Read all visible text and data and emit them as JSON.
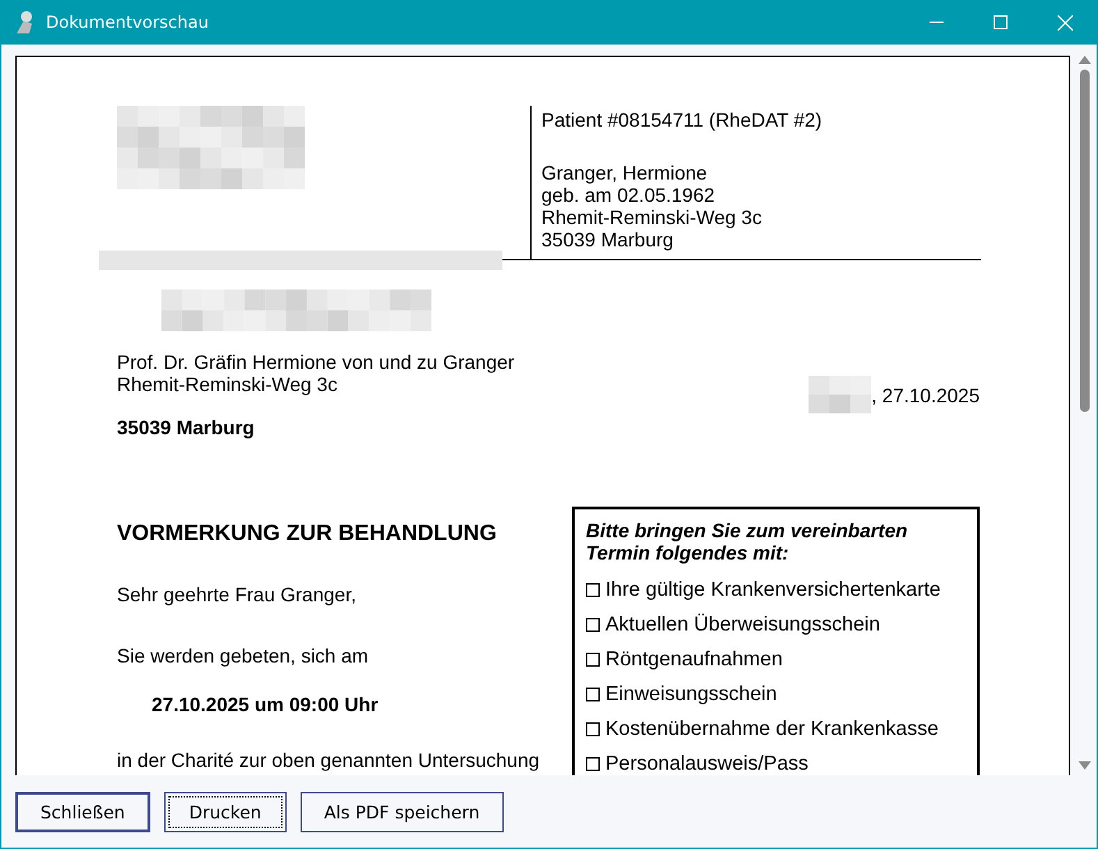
{
  "window": {
    "title": "Dokumentvorschau"
  },
  "document": {
    "patient_header": "Patient #08154711 (RheDAT #2)",
    "patient_lines": [
      "Granger, Hermione",
      "geb. am 02.05.1962",
      "Rhemit-Reminski-Weg 3c",
      "35039 Marburg"
    ],
    "recipient_lines": [
      "Prof. Dr. Gräfin Hermione von und zu Granger",
      "Rhemit-Reminski-Weg 3c"
    ],
    "recipient_city": "35039 Marburg",
    "date": ", 27.10.2025",
    "heading": "VORMERKUNG ZUR BEHANDLUNG",
    "salutation": "Sehr geehrte Frau Granger,",
    "intro": "Sie werden gebeten, sich am",
    "appointment": "27.10.2025 um 09:00 Uhr",
    "body": "in der Charité zur oben genannten Untersuchung",
    "checklist": {
      "title": "Bitte bringen Sie zum vereinbarten Termin folgendes mit:",
      "items": [
        {
          "label": "Ihre gültige Krankenversichertenkarte",
          "checked": false
        },
        {
          "label": "Aktuellen Überweisungsschein",
          "checked": false
        },
        {
          "label": "Röntgenaufnahmen",
          "checked": false
        },
        {
          "label": "Einweisungsschein",
          "checked": false
        },
        {
          "label": "Kostenübernahme der Krankenkasse",
          "checked": false
        },
        {
          "label": "Personalausweis/Pass",
          "checked": false
        }
      ]
    }
  },
  "buttons": [
    {
      "label": "Schließen",
      "kind": "default"
    },
    {
      "label": "Drucken",
      "kind": "focused"
    },
    {
      "label": "Als PDF speichern",
      "kind": "normal"
    }
  ]
}
